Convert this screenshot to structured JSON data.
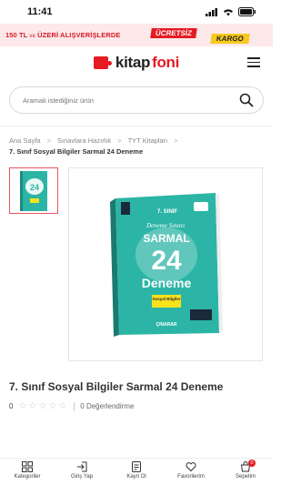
{
  "status": {
    "time": "11:41"
  },
  "promo": {
    "left_text": "150 TL",
    "ve": "ve",
    "right_text": "ÜZERİ ALIŞVERİŞLERDE",
    "free": "ÜCRETSİZ",
    "cargo": "KARGO"
  },
  "logo": {
    "kitap": "kitap",
    "foni": "foni"
  },
  "search": {
    "placeholder": "Aramak istediğiniz ürün"
  },
  "breadcrumb": {
    "items": [
      "Ana Sayfa",
      "Sınavlara Hazırlık",
      "TYT Kitapları"
    ],
    "sep": ">",
    "current": "7. Sınıf Sosyal Bilgiler Sarmal 24 Deneme"
  },
  "book": {
    "grade": "7. SINIF",
    "series": "SARMAL",
    "number": "24",
    "word": "Deneme",
    "subject": "Sosyal Bilgiler",
    "publisher": "ÇINARAR",
    "script": "Deneme Sınavı"
  },
  "product": {
    "title": "7. Sınıf Sosyal Bilgiler Sarmal 24 Deneme",
    "rating": "0",
    "reviews": "0 Değerlendirme"
  },
  "tabbar": {
    "items": [
      "Kategoriler",
      "Giriş Yap",
      "Kayıt Ol",
      "Favorilerim",
      "Sepetim"
    ],
    "cart_count": "0"
  },
  "colors": {
    "brand_red": "#e41b23",
    "cover_teal": "#2cb5a6",
    "cargo_yellow": "#f7c81e"
  }
}
